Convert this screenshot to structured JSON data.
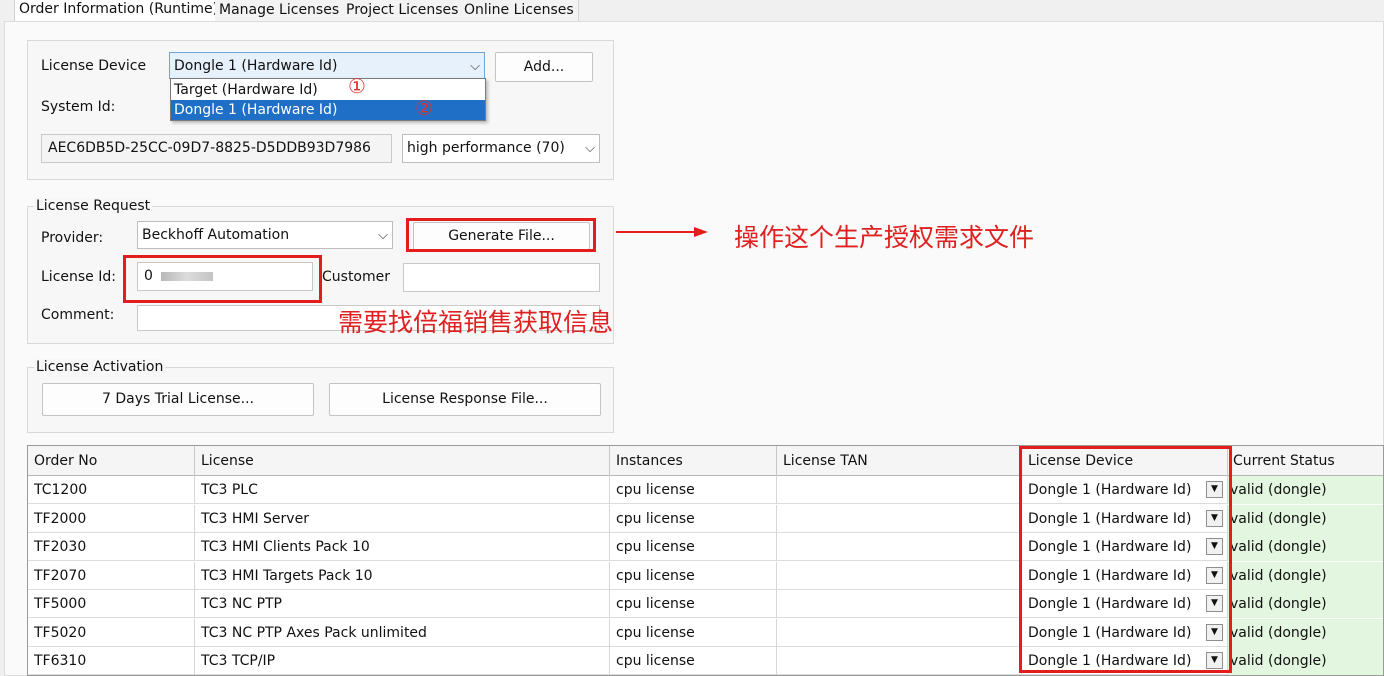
{
  "tabs": [
    {
      "label": "Order Information (Runtime)"
    },
    {
      "label": "Manage Licenses"
    },
    {
      "label": "Project Licenses"
    },
    {
      "label": "Online Licenses"
    }
  ],
  "device": {
    "license_device_label": "License Device",
    "selected": "Dongle 1 (Hardware Id)",
    "options": [
      "Target (Hardware Id)",
      "Dongle 1 (Hardware Id)"
    ],
    "add_label": "Add...",
    "system_id_label": "System Id:",
    "system_id_value": "AEC6DB5D-25CC-09D7-8825-D5DDB93D7986",
    "performance": "high performance (70)",
    "marker1": "①",
    "marker2": "②"
  },
  "request": {
    "title": "License Request",
    "provider_label": "Provider:",
    "provider_value": "Beckhoff Automation",
    "generate_label": "Generate File...",
    "license_id_label": "License Id:",
    "license_id_value": "0",
    "customer_label": "Customer",
    "customer_value": "",
    "comment_label": "Comment:",
    "comment_value": ""
  },
  "activation": {
    "title": "License Activation",
    "trial_label": "7 Days Trial License...",
    "response_label": "License Response File..."
  },
  "annotations": {
    "generate_note": "操作这个生产授权需求文件",
    "license_id_note": "需要找倍福销售获取信息"
  },
  "table": {
    "headers": [
      "Order No",
      "License",
      "Instances",
      "License TAN",
      "License Device",
      "Current Status"
    ],
    "rows": [
      {
        "order": "TC1200",
        "license": "TC3 PLC",
        "instances": "cpu license",
        "tan": "",
        "device": "Dongle 1 (Hardware Id)",
        "status": "valid (dongle)"
      },
      {
        "order": "TF2000",
        "license": "TC3 HMI Server",
        "instances": "cpu license",
        "tan": "",
        "device": "Dongle 1 (Hardware Id)",
        "status": "valid (dongle)"
      },
      {
        "order": "TF2030",
        "license": "TC3 HMI Clients Pack 10",
        "instances": "cpu license",
        "tan": "",
        "device": "Dongle 1 (Hardware Id)",
        "status": "valid (dongle)"
      },
      {
        "order": "TF2070",
        "license": "TC3 HMI Targets Pack 10",
        "instances": "cpu license",
        "tan": "",
        "device": "Dongle 1 (Hardware Id)",
        "status": "valid (dongle)"
      },
      {
        "order": "TF5000",
        "license": "TC3 NC PTP",
        "instances": "cpu license",
        "tan": "",
        "device": "Dongle 1 (Hardware Id)",
        "status": "valid (dongle)"
      },
      {
        "order": "TF5020",
        "license": "TC3 NC PTP Axes Pack unlimited",
        "instances": "cpu license",
        "tan": "",
        "device": "Dongle 1 (Hardware Id)",
        "status": "valid (dongle)"
      },
      {
        "order": "TF6310",
        "license": "TC3 TCP/IP",
        "instances": "cpu license",
        "tan": "",
        "device": "Dongle 1 (Hardware Id)",
        "status": "valid (dongle)"
      }
    ]
  },
  "colors": {
    "annotation_red": "#e31c1c",
    "selection_blue": "#1f6fc7",
    "status_green": "#e3f6df"
  }
}
